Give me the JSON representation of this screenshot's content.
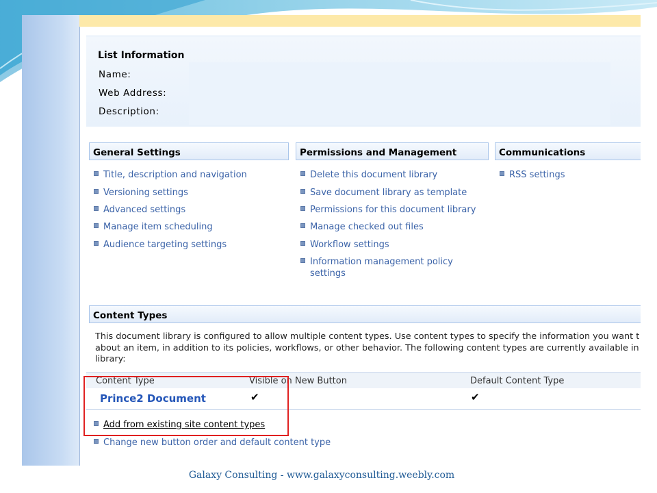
{
  "list_information": {
    "title": "List Information",
    "fields": [
      "Name:",
      "Web Address:",
      "Description:"
    ]
  },
  "sections": [
    {
      "header": "General Settings",
      "links": [
        "Title, description and navigation",
        "Versioning settings",
        "Advanced settings",
        "Manage item scheduling",
        "Audience targeting settings"
      ]
    },
    {
      "header": "Permissions and Management",
      "links": [
        "Delete this document library",
        "Save document library as template",
        "Permissions for this document library",
        "Manage checked out files",
        "Workflow settings",
        "Information management policy settings"
      ]
    },
    {
      "header": "Communications",
      "links": [
        "RSS settings"
      ]
    }
  ],
  "content_types": {
    "header": "Content Types",
    "description": "This document library is configured to allow multiple content types. Use content types to specify the information you want t about an item, in addition to its policies, workflows, or other behavior. The following content types are currently available in library:",
    "columns": [
      "Content Type",
      "Visible on New Button",
      "Default Content Type"
    ],
    "rows": [
      {
        "name": "Prince2 Document",
        "visible": "✔",
        "default": "✔"
      }
    ],
    "links": [
      "Add from existing site content types",
      "Change new button order and default content type"
    ]
  },
  "footer": "Galaxy Consulting - www.galaxyconsulting.weebly.com",
  "colors": {
    "link": "#3b63a8",
    "highlight_box": "#e02020",
    "footer_text": "#1f5a95",
    "accent_strip": "#fde9a9"
  }
}
